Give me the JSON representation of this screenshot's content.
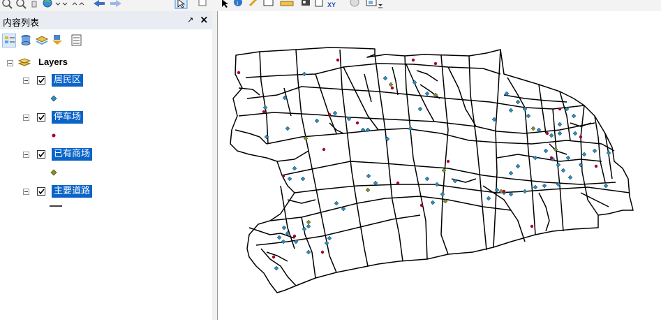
{
  "toc": {
    "title": "内容列表",
    "pin_icon": "pin-icon",
    "close_icon": "close-icon",
    "tools": [
      "list-by-drawing-order-icon",
      "list-by-source-icon",
      "list-by-visibility-icon",
      "list-by-selection-icon",
      "options-icon"
    ],
    "root": {
      "label": "Layers"
    },
    "layers": [
      {
        "label": "居民区",
        "checked": true,
        "symbol": "diamond",
        "color": "#2b8cbe"
      },
      {
        "label": "停车场",
        "checked": true,
        "symbol": "dot",
        "color": "#a50026"
      },
      {
        "label": "已有商场",
        "checked": true,
        "symbol": "diamond",
        "color": "#8c8c20"
      },
      {
        "label": "主要道路",
        "checked": true,
        "symbol": "line",
        "color": "#000000"
      }
    ]
  },
  "toolbar": {
    "icons": [
      "zoom-in-icon",
      "zoom-out-icon",
      "pan-icon",
      "full-extent-icon",
      "fixed-zoom-in-icon",
      "fixed-zoom-out-icon",
      "back-icon",
      "forward-icon",
      "select-features-icon",
      "clear-selection-icon",
      "select-elements-icon",
      "identify-icon",
      "hyperlink-icon",
      "html-popup-icon",
      "measure-icon",
      "find-icon",
      "find-route-icon",
      "go-to-xy-icon",
      "time-slider-icon",
      "viewer-icon",
      "more-tools-icon"
    ]
  },
  "map": {
    "colors": {
      "road": "#000000",
      "residential": "#2b8cbe",
      "parking": "#a50026",
      "mall": "#8c8c20"
    }
  }
}
